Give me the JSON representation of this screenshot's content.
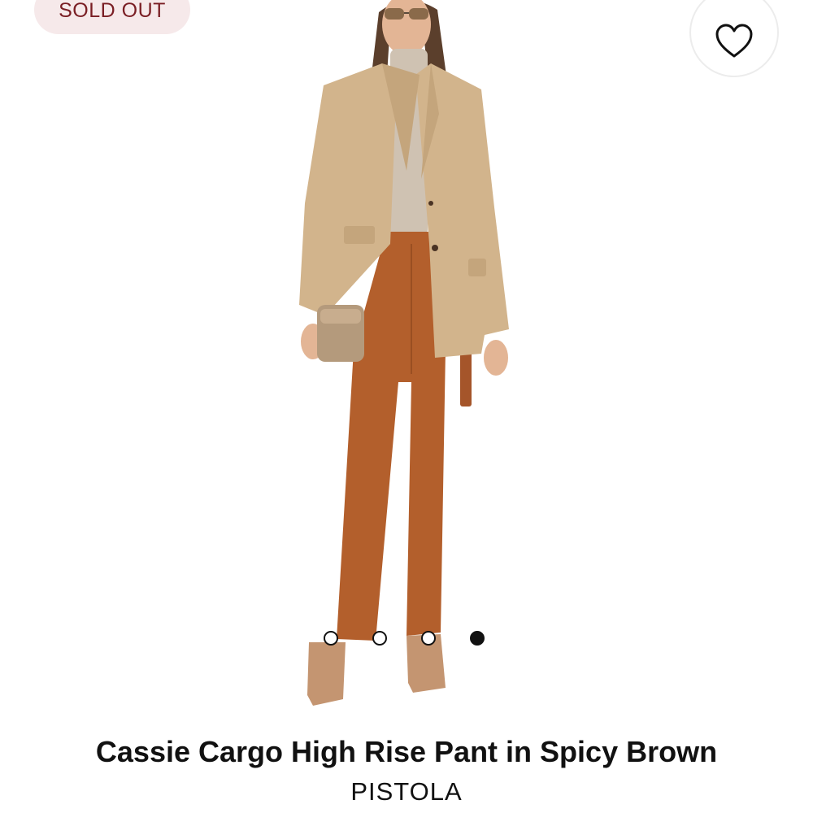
{
  "badge": {
    "label": "SOLD OUT"
  },
  "wishlist": {
    "icon": "heart-outline-icon"
  },
  "carousel": {
    "count": 4,
    "active_index": 3
  },
  "product": {
    "title": "Cassie Cargo High Rise Pant in Spicy Brown",
    "brand": "PISTOLA"
  },
  "colors": {
    "badge_bg": "#f6e9ea",
    "badge_text": "#7a1e24",
    "blazer": "#d2b48c",
    "pants": "#b35f2c",
    "boots": "#c49571"
  }
}
